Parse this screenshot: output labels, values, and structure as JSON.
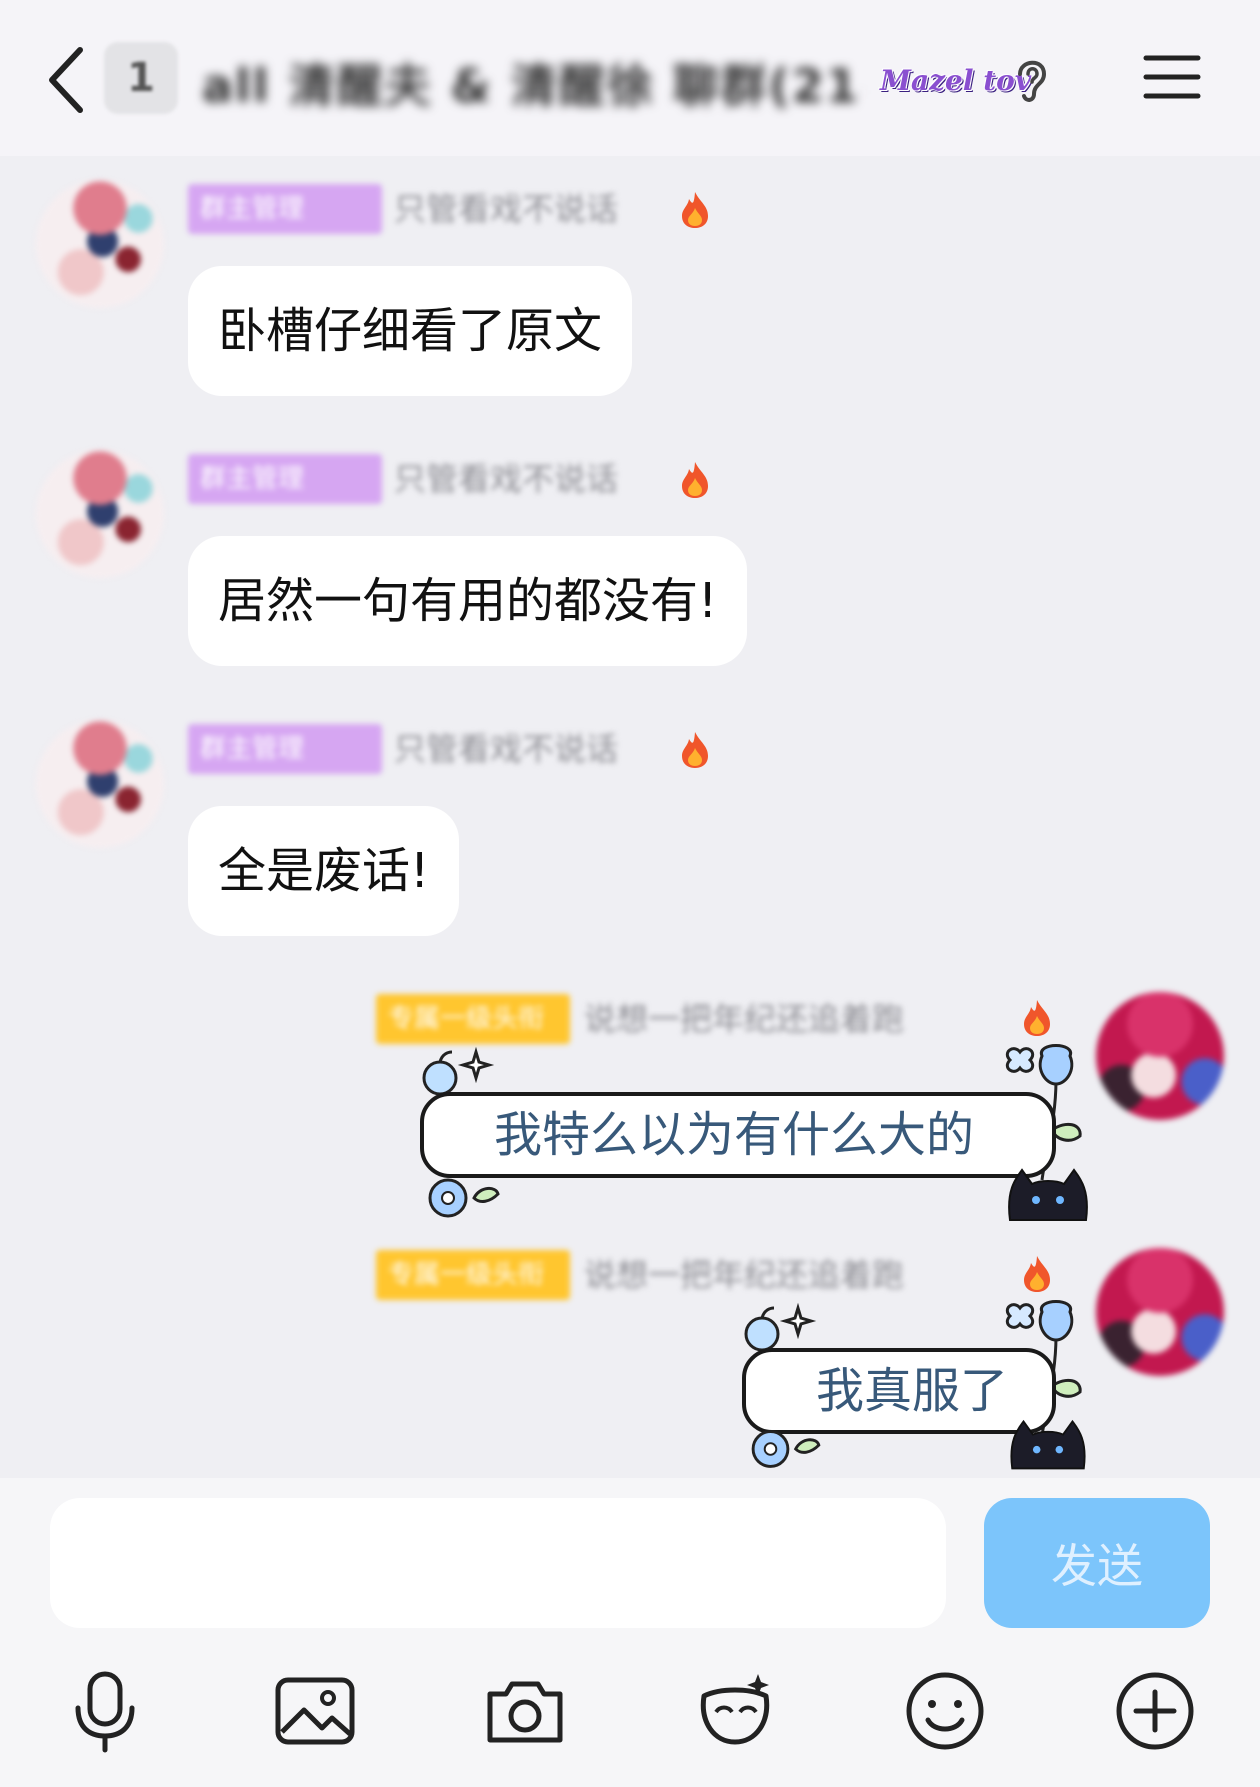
{
  "header": {
    "unread_count": "1",
    "title": "all 清醒夫 & 清醒徐 聊群(214)",
    "title_tag": "Mazel tov",
    "icons": {
      "back": "chevron-left-icon",
      "ear": "ear-icon",
      "menu": "hamburger-menu-icon"
    }
  },
  "messages": [
    {
      "side": "left",
      "badge": "群主管理",
      "nickname": "只管看戏不说话",
      "text": "卧槽仔细看了原文"
    },
    {
      "side": "left",
      "badge": "群主管理",
      "nickname": "只管看戏不说话",
      "text": "居然一句有用的都没有!"
    },
    {
      "side": "left",
      "badge": "群主管理",
      "nickname": "只管看戏不说话",
      "text": "全是废话!"
    },
    {
      "side": "right",
      "badge": "专属一级头衔",
      "nickname": "说想一把年纪还追着跑",
      "text": "我特么以为有什么大的"
    },
    {
      "side": "right",
      "badge": "专属一级头衔",
      "nickname": "说想一把年纪还追着跑",
      "text": "我真服了"
    }
  ],
  "input": {
    "value": "",
    "placeholder": "",
    "send_label": "发送"
  },
  "toolbar": {
    "items": [
      "microphone-icon",
      "image-icon",
      "camera-icon",
      "mask-icon",
      "emoji-icon",
      "plus-icon"
    ]
  },
  "colors": {
    "send_button": "#7cc5fb",
    "badge_purple": "#d6a6f2",
    "badge_gold": "#ffc62f",
    "fancy_text": "#38597a",
    "background": "#efeff3"
  }
}
